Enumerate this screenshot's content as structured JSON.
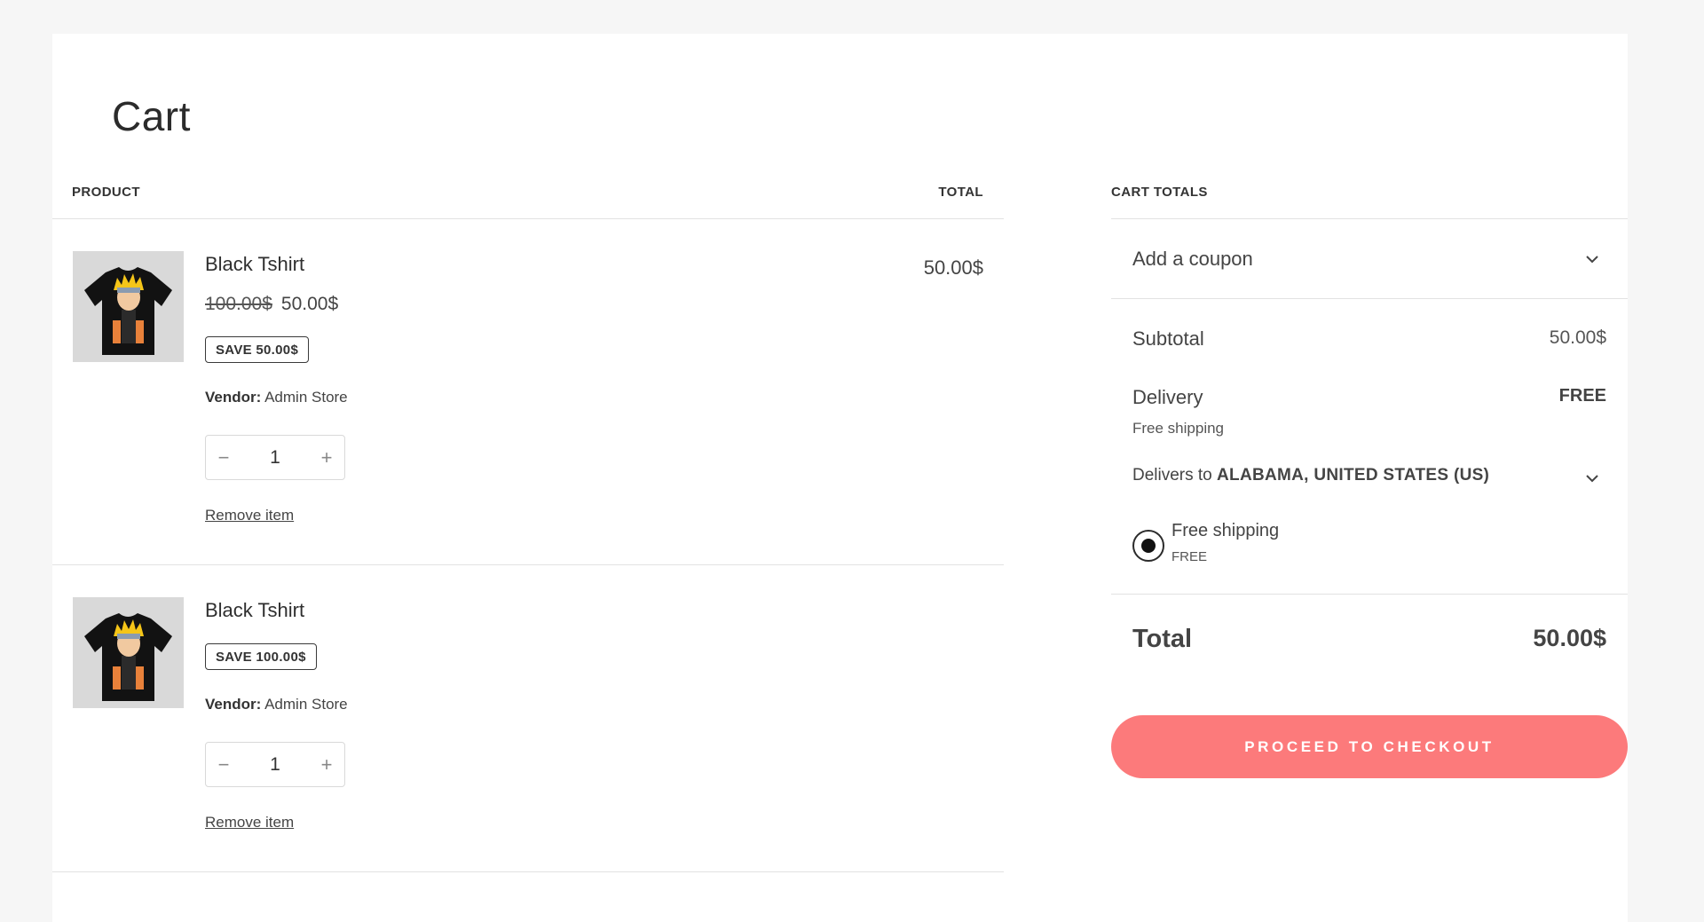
{
  "page": {
    "title": "Cart"
  },
  "products_table": {
    "header_product": "PRODUCT",
    "header_total": "TOTAL",
    "items": [
      {
        "name": "Black Tshirt",
        "price_original": "100.00$",
        "price_current": "50.00$",
        "save_badge": "SAVE 50.00$",
        "vendor_label": "Vendor:",
        "vendor_name": "Admin Store",
        "quantity": "1",
        "qty_minus": "−",
        "qty_plus": "+",
        "remove_label": "Remove item",
        "line_total": "50.00$"
      },
      {
        "name": "Black Tshirt",
        "save_badge": "SAVE 100.00$",
        "vendor_label": "Vendor:",
        "vendor_name": "Admin Store",
        "quantity": "1",
        "qty_minus": "−",
        "qty_plus": "+",
        "remove_label": "Remove item"
      }
    ]
  },
  "totals": {
    "header": "CART TOTALS",
    "coupon_label": "Add a coupon",
    "subtotal_label": "Subtotal",
    "subtotal_value": "50.00$",
    "delivery_label": "Delivery",
    "delivery_value": "FREE",
    "delivery_sub": "Free shipping",
    "delivers_to_prefix": "Delivers to",
    "delivers_to_location": "ALABAMA, UNITED STATES (US)",
    "shipping_option_name": "Free shipping",
    "shipping_option_price": "FREE",
    "total_label": "Total",
    "total_value": "50.00$",
    "checkout_label": "PROCEED TO CHECKOUT"
  },
  "colors": {
    "accent": "#fc7a7b",
    "background": "#f6f6f6",
    "panel": "#ffffff",
    "divider": "#e2e2e2"
  },
  "icons": {
    "coupon_toggle": "chevron-down-icon",
    "delivers_toggle": "chevron-down-icon",
    "product_image": "tshirt-image"
  }
}
